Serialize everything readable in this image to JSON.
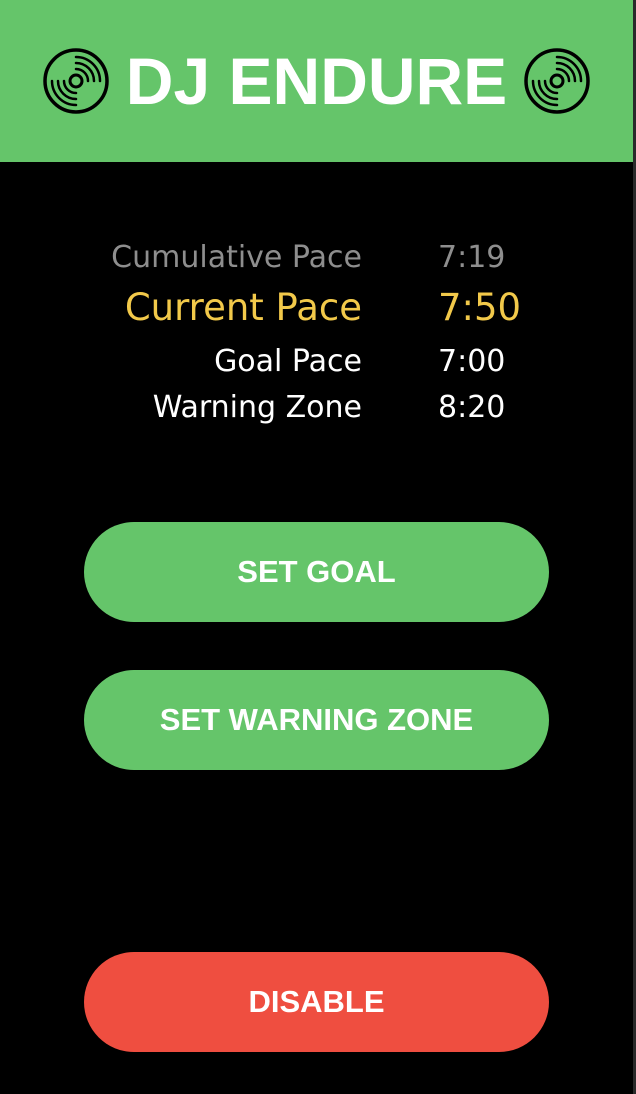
{
  "app": {
    "title": "DJ ENDURE",
    "left_icon": "vinyl-record-icon",
    "right_icon": "vinyl-record-icon"
  },
  "stats": [
    {
      "label": "Cumulative Pace",
      "value": "7:19",
      "color": "#8e8e8e"
    },
    {
      "label": "Current Pace",
      "value": "7:50",
      "color": "#f2c94a"
    },
    {
      "label": "Goal Pace",
      "value": "7:00",
      "color": "#ffffff"
    },
    {
      "label": "Warning Zone",
      "value": "8:20",
      "color": "#ffffff"
    }
  ],
  "buttons": {
    "set_goal": "SET GOAL",
    "set_warning_zone": "SET WARNING ZONE",
    "disable": "DISABLE"
  },
  "colors": {
    "brand_green": "#65c56a",
    "danger_red": "#ef4e40",
    "current_pace_yellow": "#f2c94a",
    "muted_gray": "#8e8e8e",
    "background": "#000000"
  }
}
